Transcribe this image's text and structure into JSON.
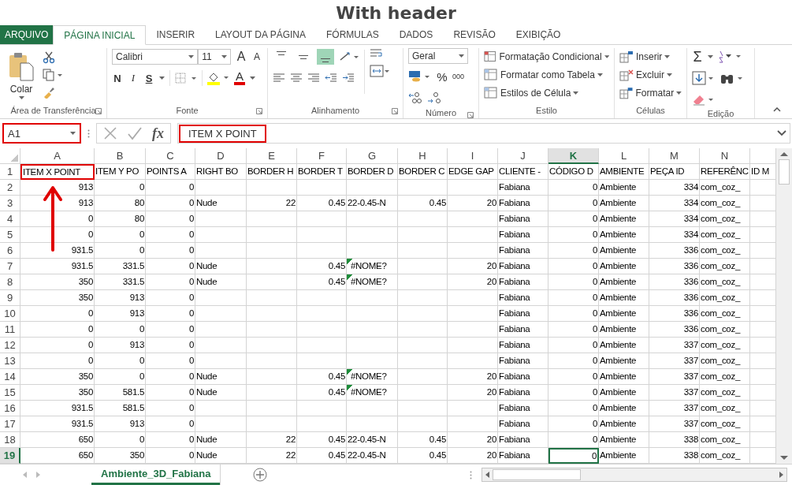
{
  "page_title": "With header",
  "ribbon_tabs": [
    {
      "label": "ARQUIVO",
      "kind": "file",
      "selected": false
    },
    {
      "label": "PÁGINA INICIAL",
      "kind": "tab",
      "selected": true
    },
    {
      "label": "INSERIR",
      "kind": "tab",
      "selected": false
    },
    {
      "label": "LAYOUT DA PÁGINA",
      "kind": "tab",
      "selected": false
    },
    {
      "label": "FÓRMULAS",
      "kind": "tab",
      "selected": false
    },
    {
      "label": "DADOS",
      "kind": "tab",
      "selected": false
    },
    {
      "label": "REVISÃO",
      "kind": "tab",
      "selected": false
    },
    {
      "label": "EXIBIÇÃO",
      "kind": "tab",
      "selected": false
    }
  ],
  "clipboard": {
    "paste": "Colar",
    "label": "Área de Transferência"
  },
  "font": {
    "name": "Calibri",
    "size": "11",
    "grow": "A",
    "shrink": "A",
    "bold": "N",
    "italic": "I",
    "underline": "S",
    "color_letter": "A",
    "label": "Fonte"
  },
  "alignment": {
    "label": "Alinhamento",
    "vertical": [
      {
        "selected": false
      },
      {
        "selected": false
      },
      {
        "selected": true
      }
    ]
  },
  "number": {
    "format": "Geral",
    "percent": "%",
    "thousands": "000",
    "label": "Número"
  },
  "styles": {
    "items": [
      "Formatação Condicional",
      "Formatar como Tabela",
      "Estilos de Célula"
    ],
    "label": "Estilo"
  },
  "cells_group": {
    "items": [
      "Inserir",
      "Excluir",
      "Formatar"
    ],
    "label": "Células"
  },
  "editing": {
    "sum": "Σ",
    "label": "Edição"
  },
  "formula_bar": {
    "name_box": "A1",
    "fx": "fx",
    "value": "ITEM X POINT"
  },
  "grid": {
    "columns": [
      {
        "letter": "A",
        "numeric": true,
        "selected": false
      },
      {
        "letter": "B",
        "numeric": true,
        "selected": false
      },
      {
        "letter": "C",
        "numeric": true,
        "selected": false
      },
      {
        "letter": "D",
        "numeric": false,
        "selected": false
      },
      {
        "letter": "E",
        "numeric": true,
        "selected": false
      },
      {
        "letter": "F",
        "numeric": true,
        "selected": false
      },
      {
        "letter": "G",
        "numeric": false,
        "selected": false
      },
      {
        "letter": "H",
        "numeric": true,
        "selected": false
      },
      {
        "letter": "I",
        "numeric": true,
        "selected": false
      },
      {
        "letter": "J",
        "numeric": false,
        "selected": false
      },
      {
        "letter": "K",
        "numeric": true,
        "selected": true
      },
      {
        "letter": "L",
        "numeric": false,
        "selected": false
      },
      {
        "letter": "M",
        "numeric": true,
        "selected": false
      },
      {
        "letter": "N",
        "numeric": false,
        "selected": false
      },
      {
        "selected": false
      }
    ],
    "rows": [
      {
        "num": "1",
        "kind": "header",
        "selected": false,
        "flagged": false,
        "cells": [
          "ITEM X POINT",
          "ITEM Y PO",
          "POINTS A",
          "RIGHT BO",
          "BORDER H",
          "BORDER T",
          "BORDER D",
          "BORDER C",
          "EDGE GAP",
          "CLIENTE -",
          "CÓDIGO D",
          "AMBIENTE",
          "PEÇA ID",
          "REFERÊNC",
          "ID M"
        ]
      },
      {
        "num": "2",
        "kind": "data",
        "selected": false,
        "flagged": false,
        "cells": [
          "913",
          "0",
          "0",
          null,
          null,
          null,
          null,
          null,
          null,
          "Fabiana",
          "0",
          "Ambiente",
          "334",
          "com_coz_",
          null
        ]
      },
      {
        "num": "3",
        "kind": "data",
        "selected": false,
        "flagged": false,
        "cells": [
          "913",
          "80",
          "0",
          "Nude",
          "22",
          "0.45",
          "22-0.45-N",
          "0.45",
          "20",
          "Fabiana",
          "0",
          "Ambiente",
          "334",
          "com_coz_",
          null
        ]
      },
      {
        "num": "4",
        "kind": "data",
        "selected": false,
        "flagged": false,
        "cells": [
          "0",
          "80",
          "0",
          null,
          null,
          null,
          null,
          null,
          null,
          "Fabiana",
          "0",
          "Ambiente",
          "334",
          "com_coz_",
          null
        ]
      },
      {
        "num": "5",
        "kind": "data",
        "selected": false,
        "flagged": false,
        "cells": [
          "0",
          "0",
          "0",
          null,
          null,
          null,
          null,
          null,
          null,
          "Fabiana",
          "0",
          "Ambiente",
          "334",
          "com_coz_",
          null
        ]
      },
      {
        "num": "6",
        "kind": "data",
        "selected": false,
        "flagged": false,
        "cells": [
          "931.5",
          "0",
          "0",
          null,
          null,
          null,
          null,
          null,
          null,
          "Fabiana",
          "0",
          "Ambiente",
          "336",
          "com_coz_",
          null
        ]
      },
      {
        "num": "7",
        "kind": "data",
        "selected": false,
        "flagged": true,
        "cells": [
          "931.5",
          "331.5",
          "0",
          "Nude",
          null,
          "0.45",
          "#NOME?",
          null,
          "20",
          "Fabiana",
          "0",
          "Ambiente",
          "336",
          "com_coz_",
          null
        ]
      },
      {
        "num": "8",
        "kind": "data",
        "selected": false,
        "flagged": true,
        "cells": [
          "350",
          "331.5",
          "0",
          "Nude",
          null,
          "0.45",
          "#NOME?",
          null,
          "20",
          "Fabiana",
          "0",
          "Ambiente",
          "336",
          "com_coz_",
          null
        ]
      },
      {
        "num": "9",
        "kind": "data",
        "selected": false,
        "flagged": false,
        "cells": [
          "350",
          "913",
          "0",
          null,
          null,
          null,
          null,
          null,
          null,
          "Fabiana",
          "0",
          "Ambiente",
          "336",
          "com_coz_",
          null
        ]
      },
      {
        "num": "10",
        "kind": "data",
        "selected": false,
        "flagged": false,
        "cells": [
          "0",
          "913",
          "0",
          null,
          null,
          null,
          null,
          null,
          null,
          "Fabiana",
          "0",
          "Ambiente",
          "336",
          "com_coz_",
          null
        ]
      },
      {
        "num": "11",
        "kind": "data",
        "selected": false,
        "flagged": false,
        "cells": [
          "0",
          "0",
          "0",
          null,
          null,
          null,
          null,
          null,
          null,
          "Fabiana",
          "0",
          "Ambiente",
          "336",
          "com_coz_",
          null
        ]
      },
      {
        "num": "12",
        "kind": "data",
        "selected": false,
        "flagged": false,
        "cells": [
          "0",
          "913",
          "0",
          null,
          null,
          null,
          null,
          null,
          null,
          "Fabiana",
          "0",
          "Ambiente",
          "337",
          "com_coz_",
          null
        ]
      },
      {
        "num": "13",
        "kind": "data",
        "selected": false,
        "flagged": false,
        "cells": [
          "0",
          "0",
          "0",
          null,
          null,
          null,
          null,
          null,
          null,
          "Fabiana",
          "0",
          "Ambiente",
          "337",
          "com_coz_",
          null
        ]
      },
      {
        "num": "14",
        "kind": "data",
        "selected": false,
        "flagged": true,
        "cells": [
          "350",
          "0",
          "0",
          "Nude",
          null,
          "0.45",
          "#NOME?",
          null,
          "20",
          "Fabiana",
          "0",
          "Ambiente",
          "337",
          "com_coz_",
          null
        ]
      },
      {
        "num": "15",
        "kind": "data",
        "selected": false,
        "flagged": true,
        "cells": [
          "350",
          "581.5",
          "0",
          "Nude",
          null,
          "0.45",
          "#NOME?",
          null,
          "20",
          "Fabiana",
          "0",
          "Ambiente",
          "337",
          "com_coz_",
          null
        ]
      },
      {
        "num": "16",
        "kind": "data",
        "selected": false,
        "flagged": false,
        "cells": [
          "931.5",
          "581.5",
          "0",
          null,
          null,
          null,
          null,
          null,
          null,
          "Fabiana",
          "0",
          "Ambiente",
          "337",
          "com_coz_",
          null
        ]
      },
      {
        "num": "17",
        "kind": "data",
        "selected": false,
        "flagged": false,
        "cells": [
          "931.5",
          "913",
          "0",
          null,
          null,
          null,
          null,
          null,
          null,
          "Fabiana",
          "0",
          "Ambiente",
          "337",
          "com_coz_",
          null
        ]
      },
      {
        "num": "18",
        "kind": "data",
        "selected": false,
        "flagged": false,
        "cells": [
          "650",
          "0",
          "0",
          "Nude",
          "22",
          "0.45",
          "22-0.45-N",
          "0.45",
          "20",
          "Fabiana",
          "0",
          "Ambiente",
          "338",
          "com_coz_",
          null
        ]
      },
      {
        "num": "19",
        "kind": "data",
        "selected": true,
        "flagged": false,
        "cells": [
          "650",
          "350",
          "0",
          "Nude",
          "22",
          "0.45",
          "22-0.45-N",
          "0.45",
          "20",
          "Fabiana",
          "0",
          "Ambiente",
          "338",
          "com_coz_",
          null
        ]
      }
    ]
  },
  "sheet_tabs": [
    {
      "label": "Ambiente_3D_Fabiana",
      "selected": true
    }
  ]
}
